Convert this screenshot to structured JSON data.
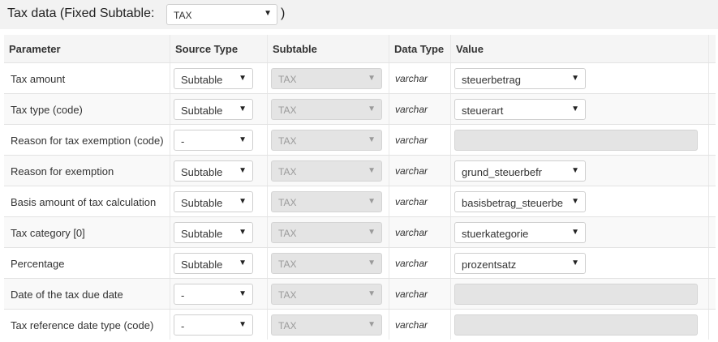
{
  "header": {
    "title": "Tax data (Fixed Subtable:",
    "subtable_value": "TAX",
    "close_paren": ")"
  },
  "columns": {
    "parameter": "Parameter",
    "source_type": "Source Type",
    "subtable": "Subtable",
    "data_type": "Data Type",
    "value": "Value"
  },
  "rows": [
    {
      "parameter": "Tax amount",
      "source": "Subtable",
      "subtable": "TAX",
      "data_type": "varchar",
      "value": "steuerbetrag"
    },
    {
      "parameter": "Tax type (code)",
      "source": "Subtable",
      "subtable": "TAX",
      "data_type": "varchar",
      "value": "steuerart"
    },
    {
      "parameter": "Reason for tax exemption (code)",
      "source": "-",
      "subtable": "TAX",
      "data_type": "varchar",
      "value": ""
    },
    {
      "parameter": "Reason for exemption",
      "source": "Subtable",
      "subtable": "TAX",
      "data_type": "varchar",
      "value": "grund_steuerbefr"
    },
    {
      "parameter": "Basis amount of tax calculation",
      "source": "Subtable",
      "subtable": "TAX",
      "data_type": "varchar",
      "value": "basisbetrag_steuerbe"
    },
    {
      "parameter": "Tax category [0]",
      "source": "Subtable",
      "subtable": "TAX",
      "data_type": "varchar",
      "value": "stuerkategorie"
    },
    {
      "parameter": "Percentage",
      "source": "Subtable",
      "subtable": "TAX",
      "data_type": "varchar",
      "value": "prozentsatz"
    },
    {
      "parameter": "Date of the tax due date",
      "source": "-",
      "subtable": "TAX",
      "data_type": "varchar",
      "value": ""
    },
    {
      "parameter": "Tax reference date type (code)",
      "source": "-",
      "subtable": "TAX",
      "data_type": "varchar",
      "value": ""
    }
  ],
  "icons": {
    "dropdown": "chevron-down-icon"
  },
  "colors": {
    "header_bg": "#f2f2f2",
    "disabled_bg": "#e4e4e4"
  }
}
